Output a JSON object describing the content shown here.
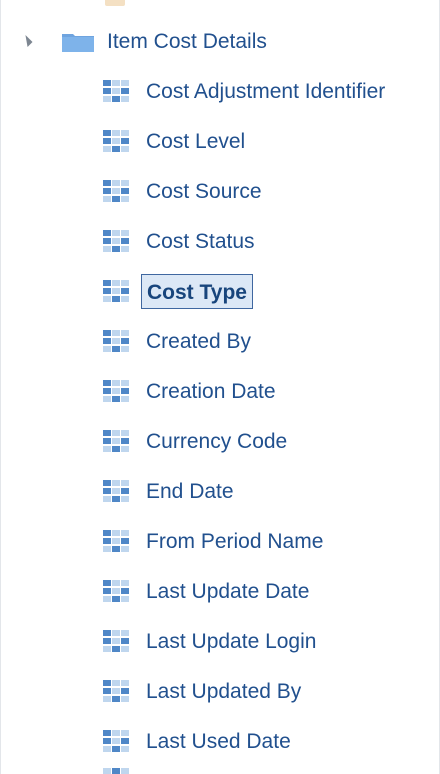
{
  "tree": {
    "parent": {
      "label": "Item Cost Details",
      "expanded": true,
      "icon": "folder-icon",
      "toggle_icon": "expanded-triangle-icon"
    },
    "children": [
      {
        "label": "Cost Adjustment Identifier",
        "icon": "grid-icon"
      },
      {
        "label": "Cost Level",
        "icon": "grid-icon"
      },
      {
        "label": "Cost Source",
        "icon": "grid-icon"
      },
      {
        "label": "Cost Status",
        "icon": "grid-icon"
      },
      {
        "label": "Cost Type",
        "icon": "grid-icon",
        "selected": true
      },
      {
        "label": "Created By",
        "icon": "grid-icon"
      },
      {
        "label": "Creation Date",
        "icon": "grid-icon"
      },
      {
        "label": "Currency Code",
        "icon": "grid-icon"
      },
      {
        "label": "End Date",
        "icon": "grid-icon"
      },
      {
        "label": "From Period Name",
        "icon": "grid-icon"
      },
      {
        "label": "Last Update Date",
        "icon": "grid-icon"
      },
      {
        "label": "Last Update Login",
        "icon": "grid-icon"
      },
      {
        "label": "Last Updated By",
        "icon": "grid-icon"
      },
      {
        "label": "Last Used Date",
        "icon": "grid-icon"
      }
    ]
  },
  "colors": {
    "text": "#21508e",
    "selected_bg": "#dce8f6",
    "selected_border": "#3f67a0",
    "folder": "#6fa4df",
    "grid_light": "#bfd6ee",
    "grid_dark": "#4f87c7"
  }
}
